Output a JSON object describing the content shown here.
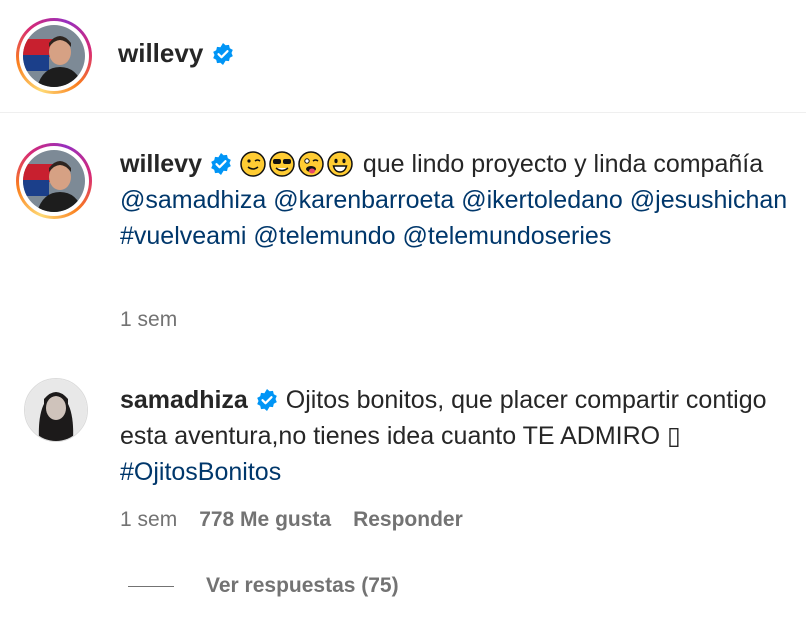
{
  "post_header": {
    "username": "willevy"
  },
  "caption": {
    "username": "willevy",
    "emojis": [
      "winking-face",
      "smiling-face-with-sunglasses",
      "winking-face-with-tongue",
      "grinning-face"
    ],
    "text": "que lindo proyecto y linda compañía",
    "mentions": [
      "@samadhiza",
      "@karenbarroeta",
      "@ikertoledano",
      "@jesushichan"
    ],
    "hashtag": "#vuelveami",
    "mentions_2": [
      "@telemundo",
      "@telemundoseries"
    ],
    "time": "1 sem"
  },
  "comment": {
    "username": "samadhiza",
    "text": "Ojitos bonitos, que placer compartir contigo esta aventura,no tienes idea cuanto TE ADMIRO ▯",
    "hashtag": "#OjitosBonitos",
    "time": "1 sem",
    "likes": "778 Me gusta",
    "reply_label": "Responder",
    "view_replies": "Ver respuestas (75)"
  },
  "colors": {
    "verified": "#0095f6",
    "link": "#00376b",
    "muted": "#737373"
  }
}
